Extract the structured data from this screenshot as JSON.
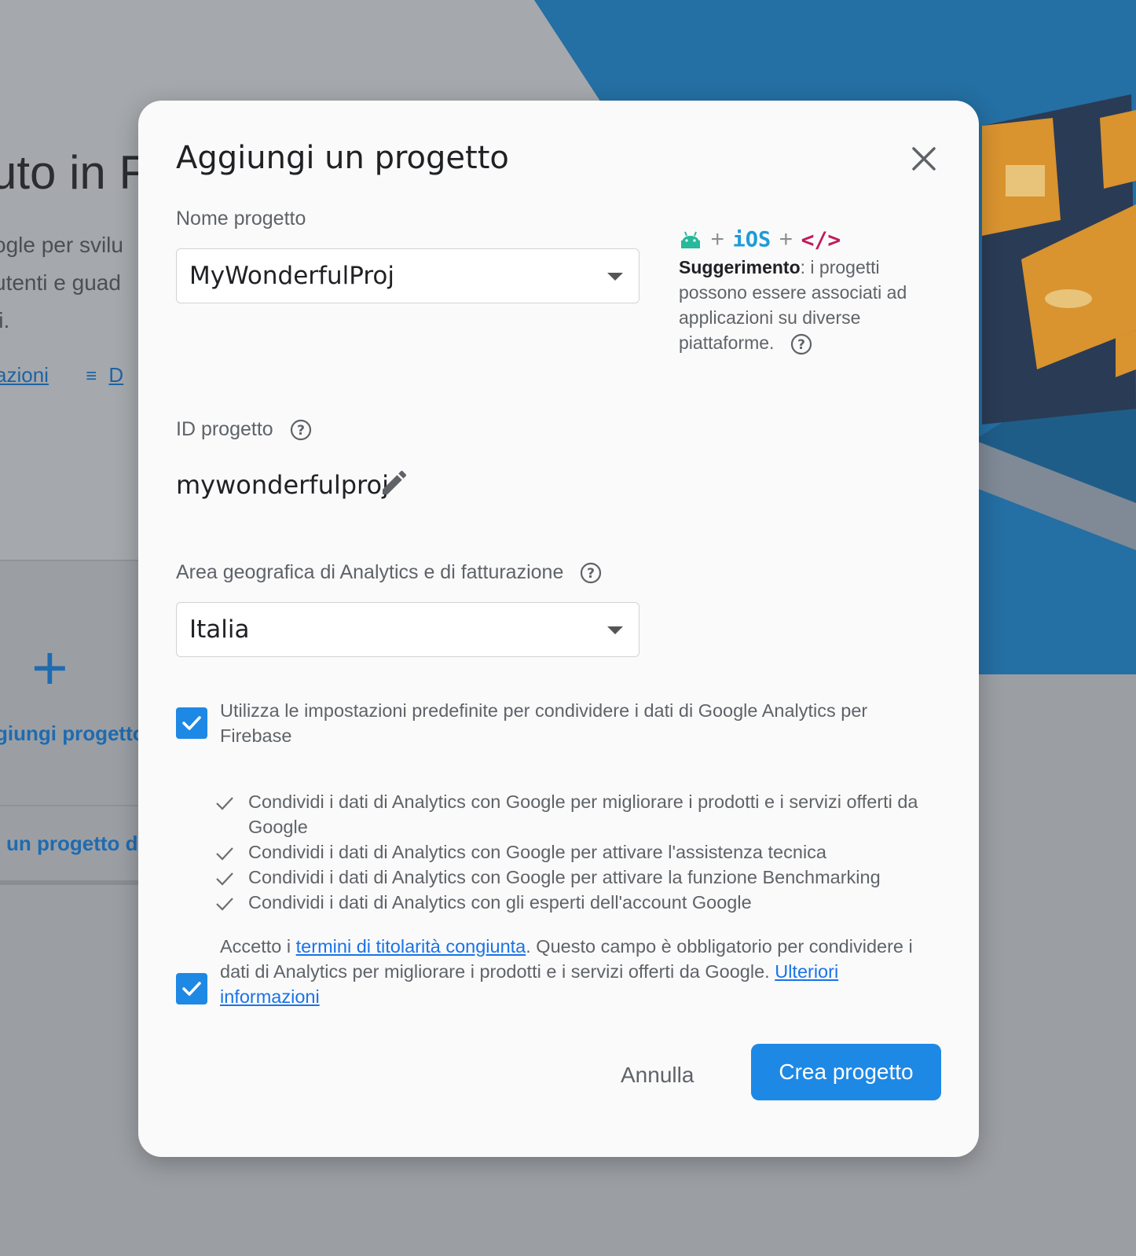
{
  "background": {
    "title": "uto in Fi",
    "description_lines": [
      "ogle per svilu",
      "utenti e guad",
      "li."
    ],
    "link_docs": "azioni",
    "link_d": "D",
    "add_project_label": "giungi progetto",
    "existing_project_label": "un progetto d"
  },
  "dialog": {
    "title": "Aggiungi un progetto",
    "project_name": {
      "label": "Nome progetto",
      "value": "MyWonderfulProj"
    },
    "tip": {
      "platforms": {
        "ios": "iOS",
        "web": "</>"
      },
      "bold": "Suggerimento",
      "text": ": i progetti possono essere associati ad applicazioni su diverse piattaforme."
    },
    "project_id": {
      "label": "ID progetto",
      "value": "mywonderfulproj"
    },
    "region": {
      "label": "Area geografica di Analytics e di fatturazione",
      "value": "Italia"
    },
    "default_settings": {
      "checked": true,
      "text": "Utilizza le impostazioni predefinite per condividere i dati di Google Analytics per Firebase"
    },
    "sharing_items": [
      "Condividi i dati di Analytics con Google per migliorare i prodotti e i servizi offerti da Google",
      "Condividi i dati di Analytics con Google per attivare l'assistenza tecnica",
      "Condividi i dati di Analytics con Google per attivare la funzione Benchmarking",
      "Condividi i dati di Analytics con gli esperti dell'account Google"
    ],
    "terms": {
      "checked": true,
      "prefix": "Accetto i ",
      "link": "termini di titolarità congiunta",
      "middle": ". Questo campo è obbligatorio per condividere i dati di Analytics per migliorare i prodotti e i servizi offerti da Google. ",
      "more_link": "Ulteriori informazioni"
    },
    "cancel_label": "Annulla",
    "create_label": "Crea progetto"
  },
  "colors": {
    "accent": "#1e88e5",
    "link": "#1a73e8",
    "android": "#26b99a",
    "ios": "#1e9bd7",
    "web": "#c2185b"
  }
}
